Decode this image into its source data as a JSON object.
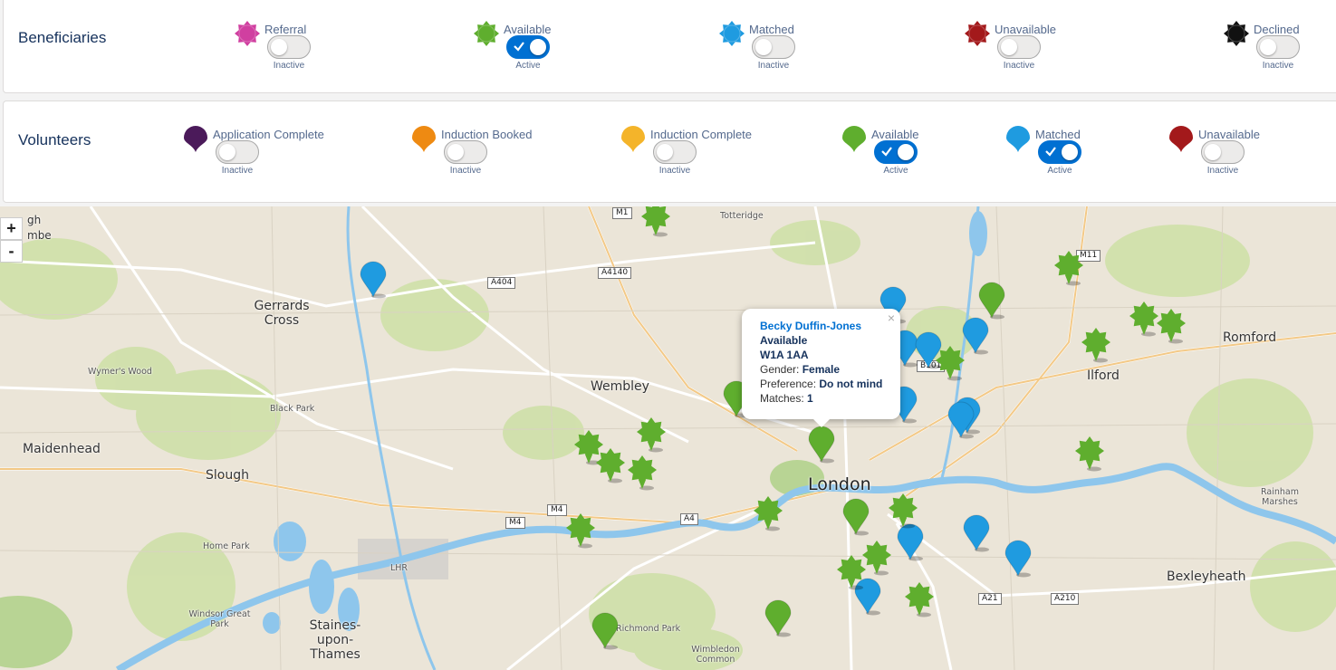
{
  "beneficiaries": {
    "title": "Beneficiaries",
    "filters": [
      {
        "label": "Referral",
        "status": "Inactive",
        "on": false,
        "color": "#d03fa0",
        "shape": "gear"
      },
      {
        "label": "Available",
        "status": "Active",
        "on": true,
        "color": "#5fae2e",
        "shape": "gear"
      },
      {
        "label": "Matched",
        "status": "Inactive",
        "on": false,
        "color": "#1f9be0",
        "shape": "gear"
      },
      {
        "label": "Unavailable",
        "status": "Inactive",
        "on": false,
        "color": "#a3191b",
        "shape": "gear"
      },
      {
        "label": "Declined",
        "status": "Inactive",
        "on": false,
        "color": "#111111",
        "shape": "gear"
      }
    ]
  },
  "volunteers": {
    "title": "Volunteers",
    "filters": [
      {
        "label": "Application Complete",
        "status": "Inactive",
        "on": false,
        "color": "#4b1a5a",
        "shape": "pin"
      },
      {
        "label": "Induction Booked",
        "status": "Inactive",
        "on": false,
        "color": "#ee8a12",
        "shape": "pin"
      },
      {
        "label": "Induction Complete",
        "status": "Inactive",
        "on": false,
        "color": "#f4b42a",
        "shape": "pin"
      },
      {
        "label": "Available",
        "status": "Active",
        "on": true,
        "color": "#5fae2e",
        "shape": "pin"
      },
      {
        "label": "Matched",
        "status": "Active",
        "on": true,
        "color": "#1f9be0",
        "shape": "pin"
      },
      {
        "label": "Unavailable",
        "status": "Inactive",
        "on": false,
        "color": "#a3191b",
        "shape": "pin"
      }
    ]
  },
  "map": {
    "zoom_in": "+",
    "zoom_out": "-",
    "places": [
      "Totteridge",
      "Gerrards Cross",
      "Wembley",
      "Romford",
      "Ilford",
      "Wymer's Wood",
      "Black Park",
      "Maidenhead",
      "Slough",
      "London",
      "Home Park",
      "LHR",
      "Windsor Great Park",
      "Staines-upon-Thames",
      "Richmond Park",
      "Wimbledon Common",
      "Bexleyheath",
      "Rainham Marshes",
      "gh",
      "mbe"
    ],
    "roads": [
      "M1",
      "A404",
      "A4140",
      "M11",
      "B101",
      "M4",
      "M4",
      "A4",
      "A21",
      "A210"
    ]
  },
  "popup": {
    "name": "Becky Duffin-Jones",
    "status": "Available",
    "postcode": "W1A 1AA",
    "gender_label": "Gender:",
    "gender": "Female",
    "preference_label": "Preference:",
    "preference": "Do not mind",
    "matches_label": "Matches:",
    "matches": "1",
    "close": "×"
  }
}
